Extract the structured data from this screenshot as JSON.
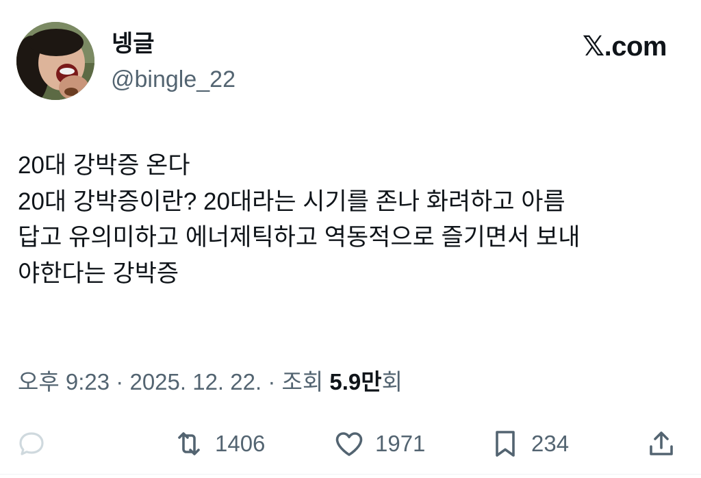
{
  "author": {
    "display_name": "넹글",
    "handle": "@bingle_22"
  },
  "brand": {
    "x_mark": "𝕏",
    "domain": ".com"
  },
  "tweet": {
    "lines": [
      "20대 강박증 온다",
      "20대 강박증이란? 20대라는 시기를 존나 화려하고 아름",
      "답고 유의미하고 에너제틱하고 역동적으로 즐기면서 보내",
      "야한다는 강박증"
    ]
  },
  "meta": {
    "time": "오후 9:23",
    "separator": "·",
    "date": "2025. 12. 22.",
    "views_label": "조회",
    "views_count": "5.9만",
    "views_suffix": "회"
  },
  "actions": {
    "reply": {
      "icon": "reply-icon",
      "count": ""
    },
    "retweet": {
      "icon": "retweet-icon",
      "count": "1406"
    },
    "like": {
      "icon": "heart-icon",
      "count": "1971"
    },
    "bookmark": {
      "icon": "bookmark-icon",
      "count": "234"
    },
    "share": {
      "icon": "share-icon",
      "count": ""
    }
  },
  "colors": {
    "text_primary": "#0f1419",
    "text_secondary": "#536471",
    "reply_icon_faded": "#cfd9de"
  }
}
